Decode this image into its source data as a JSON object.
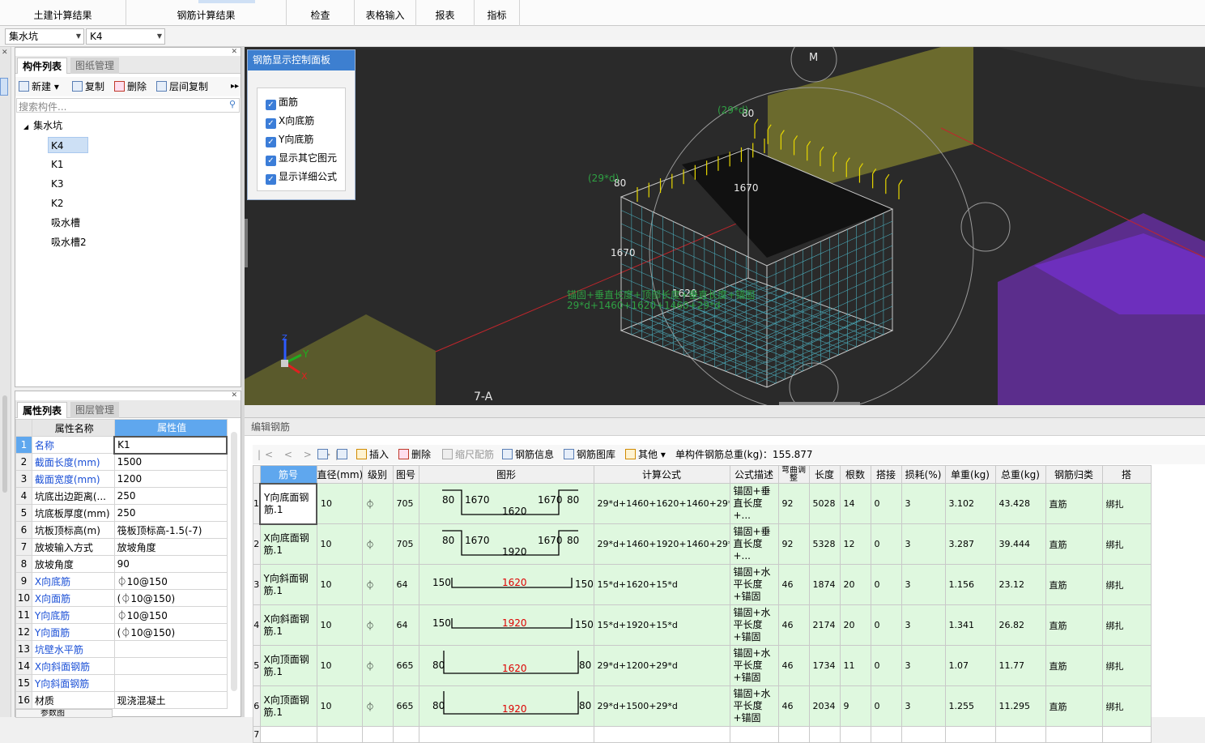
{
  "ribbon": {
    "tabs": [
      "土建计算结果",
      "钢筋计算结果",
      "检查",
      "表格输入",
      "报表",
      "指标"
    ]
  },
  "combos": {
    "type": "集水坑",
    "name": "K4"
  },
  "component_panel": {
    "tabs": [
      "构件列表",
      "图纸管理"
    ],
    "toolbar": {
      "new": "新建",
      "copy": "复制",
      "delete": "删除",
      "floor_copy": "层间复制"
    },
    "search_placeholder": "搜索构件...",
    "tree": {
      "root": "集水坑",
      "items": [
        "K4",
        "K1",
        "K3",
        "K2",
        "吸水槽",
        "吸水槽2"
      ],
      "selected": "K4"
    }
  },
  "property_panel": {
    "tabs": [
      "属性列表",
      "图层管理"
    ],
    "headers": {
      "name": "属性名称",
      "value": "属性值"
    },
    "rows": [
      {
        "n": "1",
        "name": "名称",
        "value": "K1",
        "blue": true
      },
      {
        "n": "2",
        "name": "截面长度(mm)",
        "value": "1500",
        "blue": true
      },
      {
        "n": "3",
        "name": "截面宽度(mm)",
        "value": "1200",
        "blue": true
      },
      {
        "n": "4",
        "name": "坑底出边距离(...",
        "value": "250",
        "blue": false
      },
      {
        "n": "5",
        "name": "坑底板厚度(mm)",
        "value": "250",
        "blue": false
      },
      {
        "n": "6",
        "name": "坑板顶标高(m)",
        "value": "筏板顶标高-1.5(-7)",
        "blue": false
      },
      {
        "n": "7",
        "name": "放坡输入方式",
        "value": "放坡角度",
        "blue": false
      },
      {
        "n": "8",
        "name": "放坡角度",
        "value": "90",
        "blue": false
      },
      {
        "n": "9",
        "name": "X向底筋",
        "value": "⏀10@150",
        "blue": true
      },
      {
        "n": "10",
        "name": "X向面筋",
        "value": "(⏀10@150)",
        "blue": true
      },
      {
        "n": "11",
        "name": "Y向底筋",
        "value": "⏀10@150",
        "blue": true
      },
      {
        "n": "12",
        "name": "Y向面筋",
        "value": "(⏀10@150)",
        "blue": true
      },
      {
        "n": "13",
        "name": "坑壁水平筋",
        "value": "",
        "blue": true
      },
      {
        "n": "14",
        "name": "X向斜面钢筋",
        "value": "",
        "blue": true
      },
      {
        "n": "15",
        "name": "Y向斜面钢筋",
        "value": "",
        "blue": true
      },
      {
        "n": "16",
        "name": "材质",
        "value": "现浇混凝土",
        "blue": false
      }
    ],
    "bottom_tab": "参数图"
  },
  "control_panel": {
    "title": "钢筋显示控制面板",
    "options": [
      "面筋",
      "X向底筋",
      "Y向底筋",
      "显示其它图元",
      "显示详细公式"
    ]
  },
  "viewport": {
    "labels": {
      "m": "M",
      "axis": "7-A",
      "d80a": "80",
      "d80b": "80",
      "d1670a": "1670",
      "d1670b": "1670",
      "d1620": "1620",
      "d29a": "(29*d)",
      "d29b": "(29*d)",
      "formula1": "锚固+垂直长度+顶部长度+垂直长度+锚固",
      "formula2": "29*d+1460+1620+1460+29*d"
    },
    "axes": {
      "x": "X",
      "y": "Y",
      "z": "Z"
    }
  },
  "editor": {
    "title": "编辑钢筋",
    "toolbar": {
      "insert": "插入",
      "delete": "删除",
      "scale": "缩尺配筋",
      "info": "钢筋信息",
      "lib": "钢筋图库",
      "other": "其他",
      "total": "单构件钢筋总重(kg)：155.877"
    },
    "columns": [
      "筋号",
      "直径(mm)",
      "级别",
      "图号",
      "图形",
      "计算公式",
      "公式描述",
      "弯曲调整",
      "长度",
      "根数",
      "搭接",
      "损耗(%)",
      "单重(kg)",
      "总重(kg)",
      "钢筋归类",
      "搭"
    ],
    "rows": [
      {
        "no": "Y向底面钢筋.1",
        "dia": "10",
        "grade": "⏀",
        "fig": "705",
        "s": {
          "l": "80",
          "a": "1670",
          "m": "1620",
          "b": "1670",
          "r": "80",
          "type": "u"
        },
        "formula": "29*d+1460+1620+1460+29*d",
        "desc": "锚固+垂直长度+...",
        "bend": "92",
        "len": "5028",
        "count": "14",
        "lap": "0",
        "loss": "3",
        "unit": "3.102",
        "total": "43.428",
        "cls": "直筋",
        "conn": "绑扎"
      },
      {
        "no": "X向底面钢筋.1",
        "dia": "10",
        "grade": "⏀",
        "fig": "705",
        "s": {
          "l": "80",
          "a": "1670",
          "m": "1920",
          "b": "1670",
          "r": "80",
          "type": "u"
        },
        "formula": "29*d+1460+1920+1460+29*d",
        "desc": "锚固+垂直长度+...",
        "bend": "92",
        "len": "5328",
        "count": "12",
        "lap": "0",
        "loss": "3",
        "unit": "3.287",
        "total": "39.444",
        "cls": "直筋",
        "conn": "绑扎"
      },
      {
        "no": "Y向斜面钢筋.1",
        "dia": "10",
        "grade": "⏀",
        "fig": "64",
        "s": {
          "l": "150",
          "m": "1620",
          "r": "150",
          "type": "c"
        },
        "formula": "15*d+1620+15*d",
        "desc": "锚固+水平长度+锚固",
        "bend": "46",
        "len": "1874",
        "count": "20",
        "lap": "0",
        "loss": "3",
        "unit": "1.156",
        "total": "23.12",
        "cls": "直筋",
        "conn": "绑扎"
      },
      {
        "no": "X向斜面钢筋.1",
        "dia": "10",
        "grade": "⏀",
        "fig": "64",
        "s": {
          "l": "150",
          "m": "1920",
          "r": "150",
          "type": "c"
        },
        "formula": "15*d+1920+15*d",
        "desc": "锚固+水平长度+锚固",
        "bend": "46",
        "len": "2174",
        "count": "20",
        "lap": "0",
        "loss": "3",
        "unit": "1.341",
        "total": "26.82",
        "cls": "直筋",
        "conn": "绑扎"
      },
      {
        "no": "X向顶面钢筋.1",
        "dia": "10",
        "grade": "⏀",
        "fig": "665",
        "s": {
          "l": "80",
          "m": "1620",
          "r": "80",
          "type": "t"
        },
        "formula": "29*d+1200+29*d",
        "desc": "锚固+水平长度+锚固",
        "bend": "46",
        "len": "1734",
        "count": "11",
        "lap": "0",
        "loss": "3",
        "unit": "1.07",
        "total": "11.77",
        "cls": "直筋",
        "conn": "绑扎"
      },
      {
        "no": "X向顶面钢筋.1",
        "dia": "10",
        "grade": "⏀",
        "fig": "665",
        "s": {
          "l": "80",
          "m": "1920",
          "r": "80",
          "type": "t"
        },
        "formula": "29*d+1500+29*d",
        "desc": "锚固+水平长度+锚固",
        "bend": "46",
        "len": "2034",
        "count": "9",
        "lap": "0",
        "loss": "3",
        "unit": "1.255",
        "total": "11.295",
        "cls": "直筋",
        "conn": "绑扎"
      }
    ],
    "last_index": "7"
  }
}
